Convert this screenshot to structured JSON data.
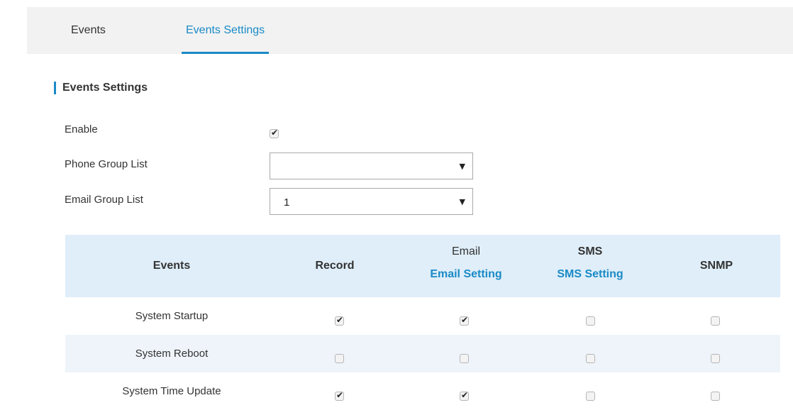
{
  "tabs": [
    {
      "label": "Events",
      "active": false
    },
    {
      "label": "Events Settings",
      "active": true
    }
  ],
  "section": {
    "title": "Events Settings"
  },
  "form": {
    "enable": {
      "label": "Enable",
      "checked": true
    },
    "phone_group": {
      "label": "Phone Group List",
      "value": ""
    },
    "email_group": {
      "label": "Email Group List",
      "value": "1"
    }
  },
  "table": {
    "headers": {
      "events": "Events",
      "record": "Record",
      "email": "Email",
      "email_link": "Email Setting",
      "sms": "SMS",
      "sms_link": "SMS Setting",
      "snmp": "SNMP"
    },
    "rows": [
      {
        "event": "System Startup",
        "record": true,
        "email": true,
        "sms": false,
        "snmp": false
      },
      {
        "event": "System Reboot",
        "record": false,
        "email": false,
        "sms": false,
        "snmp": false
      },
      {
        "event": "System Time Update",
        "record": true,
        "email": true,
        "sms": false,
        "snmp": false
      }
    ]
  },
  "icons": {
    "dropdown": "chevron-down-icon",
    "check": "checkmark-icon"
  },
  "colors": {
    "accent": "#1a8ac6",
    "header_bg": "#dfeef9",
    "row_alt_bg": "#eef4fa",
    "tabbar_bg": "#f2f2f2"
  }
}
